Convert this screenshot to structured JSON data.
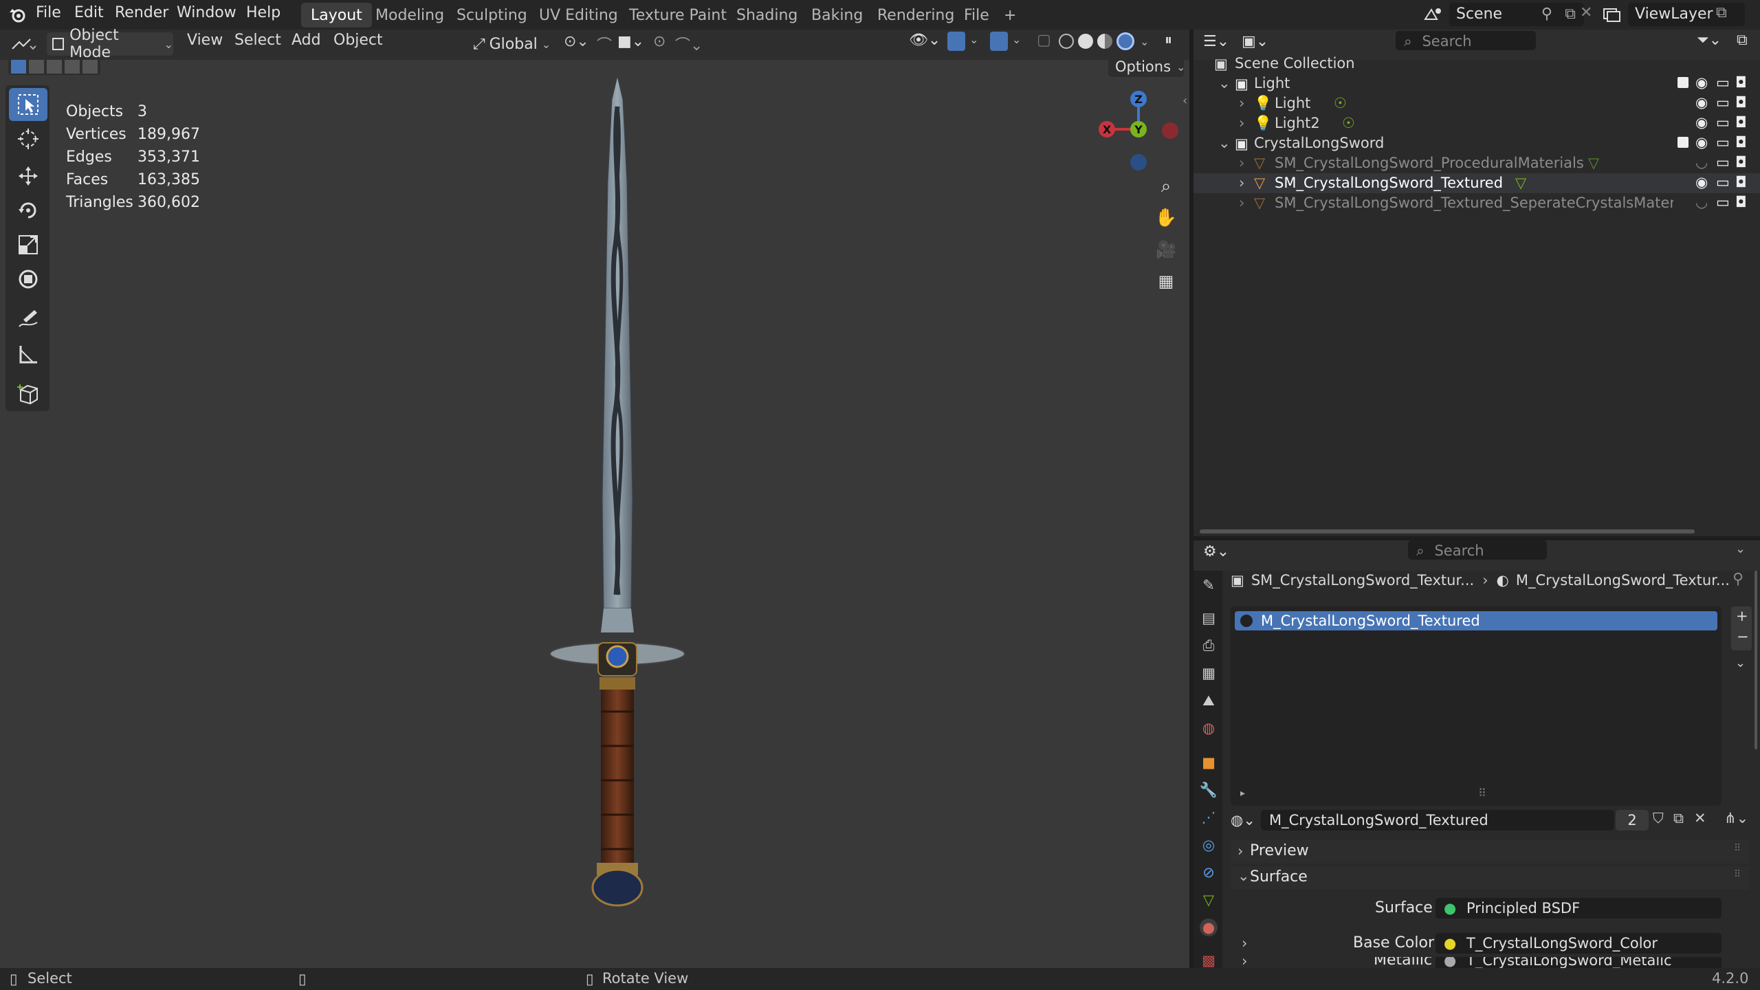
{
  "topbar": {
    "menus": [
      "File",
      "Edit",
      "Render",
      "Window",
      "Help"
    ],
    "workspaces": [
      "Layout",
      "Modeling",
      "Sculpting",
      "UV Editing",
      "Texture Paint",
      "Shading",
      "Baking",
      "Rendering",
      "File"
    ],
    "active_workspace": "Layout",
    "add_workspace": "+",
    "scene": "Scene",
    "view_layer": "ViewLayer"
  },
  "viewport": {
    "mode": "Object Mode",
    "menus": [
      "View",
      "Select",
      "Add",
      "Object"
    ],
    "orientation": "Global",
    "options_label": "Options",
    "stats": [
      {
        "label": "Objects",
        "value": "3"
      },
      {
        "label": "Vertices",
        "value": "189,967"
      },
      {
        "label": "Edges",
        "value": "353,371"
      },
      {
        "label": "Faces",
        "value": "163,385"
      },
      {
        "label": "Triangles",
        "value": "360,602"
      }
    ],
    "gizmo": {
      "x": "X",
      "y": "Y",
      "z": "Z"
    }
  },
  "outliner": {
    "search_placeholder": "Search",
    "scene_collection": "Scene Collection",
    "rows": [
      {
        "name": "Light",
        "kind": "collection",
        "dim": false
      },
      {
        "name": "Light",
        "kind": "light",
        "dim": false
      },
      {
        "name": "Light2",
        "kind": "light",
        "dim": false
      },
      {
        "name": "CrystalLongSword",
        "kind": "collection",
        "dim": false
      },
      {
        "name": "SM_CrystalLongSword_ProceduralMaterials",
        "kind": "mesh",
        "dim": true
      },
      {
        "name": "SM_CrystalLongSword_Textured",
        "kind": "mesh",
        "dim": false
      },
      {
        "name": "SM_CrystalLongSword_Textured_SeperateCrystalsMaterials",
        "kind": "mesh",
        "dim": true
      }
    ]
  },
  "properties": {
    "search_placeholder": "Search",
    "breadcrumb_object": "SM_CrystalLongSword_Textur...",
    "breadcrumb_material": "M_CrystalLongSword_Textur...",
    "slot_name": "M_CrystalLongSword_Textured",
    "material_name": "M_CrystalLongSword_Textured",
    "users": "2",
    "preview_label": "Preview",
    "surface_panel": "Surface",
    "surface_label": "Surface",
    "surface_value": "Principled BSDF",
    "base_color_label": "Base Color",
    "base_color_value": "T_CrystalLongSword_Color",
    "metallic_label": "Metallic",
    "metallic_value": "T_CrystalLongSword_Metalic"
  },
  "statusbar": {
    "left": "Select",
    "middle": "Rotate View",
    "version": "4.2.0"
  },
  "colors": {
    "accent": "#4774b5",
    "viewport_bg": "#393939",
    "panel_bg": "#2a2a2a",
    "axis_x": "#c8343e",
    "axis_y": "#7ab41e",
    "axis_z": "#3e79cc"
  }
}
